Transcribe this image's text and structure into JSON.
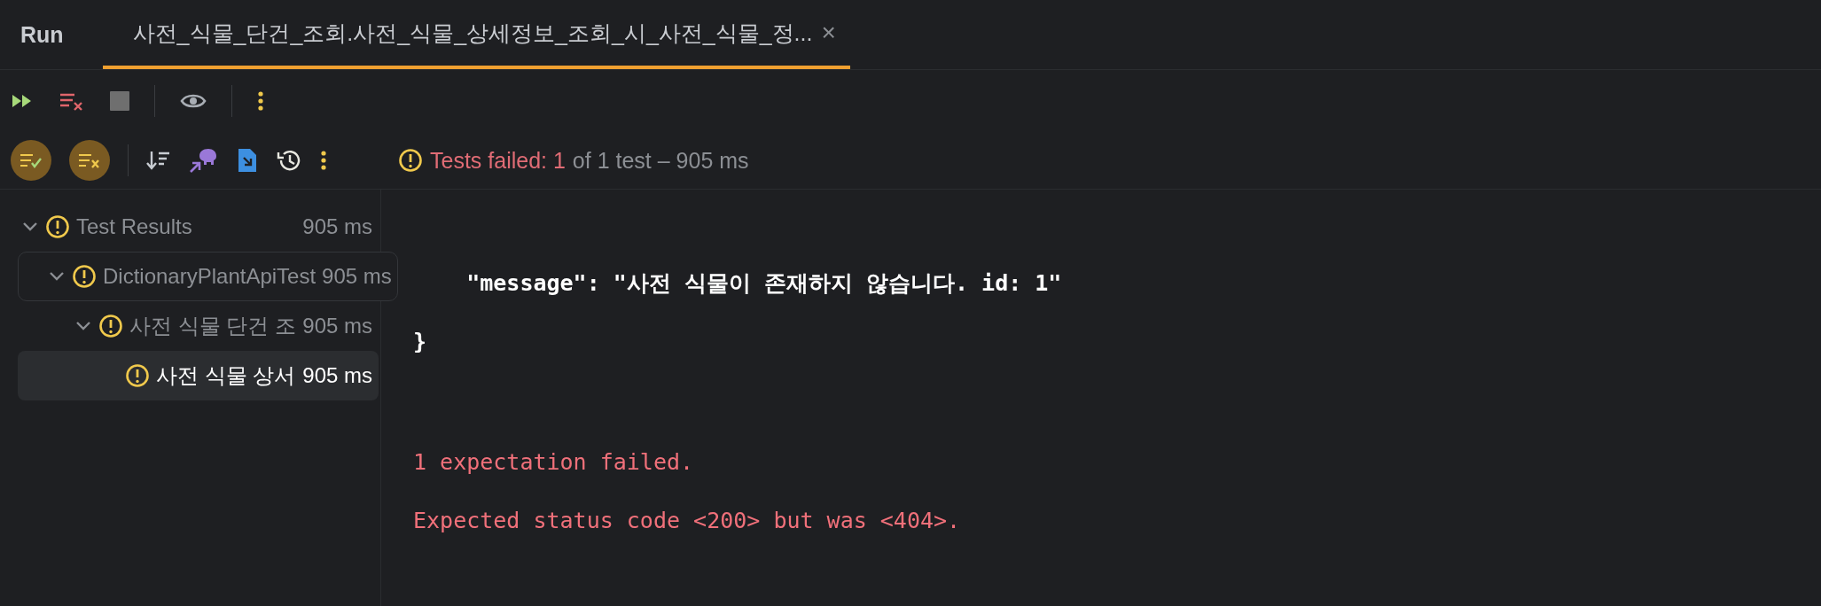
{
  "panel_title": "Run",
  "tabs": [
    {
      "label": "사전_식물_단건_조회.사전_식물_상세정보_조회_시_사전_식물_정...",
      "selected": true,
      "close": "×"
    }
  ],
  "toolbar_top": [
    {
      "kind": "rerun"
    },
    {
      "kind": "clear"
    },
    {
      "kind": "stop",
      "disabled": true
    },
    {
      "kind": "divider"
    },
    {
      "kind": "eye"
    },
    {
      "kind": "divider"
    },
    {
      "kind": "more"
    }
  ],
  "toolbar_tests": [
    {
      "kind": "show-passed",
      "selected": true
    },
    {
      "kind": "show-failed",
      "selected": true
    },
    {
      "kind": "divider"
    },
    {
      "kind": "sort"
    },
    {
      "kind": "gradle"
    },
    {
      "kind": "export"
    },
    {
      "kind": "history"
    },
    {
      "kind": "more"
    }
  ],
  "summary": {
    "failed": "Tests failed: 1",
    "rest": "of 1 test – 905 ms"
  },
  "tree": [
    {
      "label": "Test Results",
      "time": "905 ms",
      "selected": false,
      "expanded": true,
      "hovered": false,
      "children": [
        {
          "label": "DictionaryPlantApiTest",
          "time": "905 ms",
          "selected": false,
          "expanded": true,
          "hovered": true,
          "children": [
            {
              "label": "사전 식물 단건 조",
              "time": "905 ms",
              "selected": false,
              "expanded": true,
              "hovered": false,
              "children": [
                {
                  "label": "사전 식물 상서",
                  "time": "905 ms",
                  "selected": true,
                  "hovered": false
                }
              ]
            }
          ]
        }
      ]
    }
  ],
  "console": {
    "output_lines": [
      "    \"message\": \"사전 식물이 존재하지 않습니다. id: 1\"",
      "}"
    ],
    "error_lines": [
      "1 expectation failed.",
      "Expected status code <200> but was <404>."
    ]
  }
}
